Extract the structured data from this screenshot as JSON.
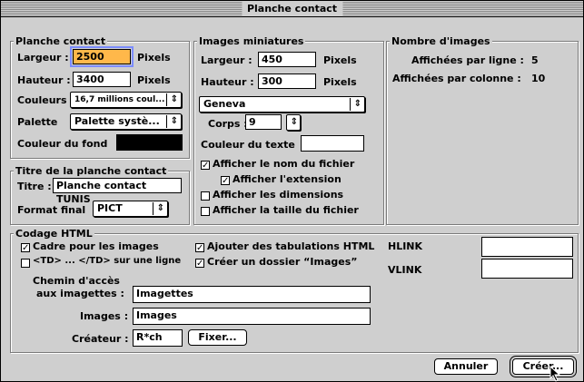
{
  "window": {
    "title": "Planche contact"
  },
  "planche": {
    "title": "Planche contact",
    "largeur_label": "Largeur :",
    "largeur_value": "2500",
    "largeur_unit": "Pixels",
    "hauteur_label": "Hauteur :",
    "hauteur_value": "3400",
    "hauteur_unit": "Pixels",
    "couleurs_label": "Couleurs",
    "couleurs_value": "16,7 millions coul...",
    "palette_label": "Palette",
    "palette_value": "Palette systè...",
    "fond_label": "Couleur du fond",
    "fond_color": "#000000"
  },
  "miniatures": {
    "title": "Images miniatures",
    "largeur_label": "Largeur :",
    "largeur_value": "450",
    "largeur_unit": "Pixels",
    "hauteur_label": "Hauteur :",
    "hauteur_value": "300",
    "hauteur_unit": "Pixels",
    "font_value": "Geneva",
    "corps_label": "Corps :",
    "corps_value": "9",
    "texte_label": "Couleur du texte",
    "texte_color": "#ffffff",
    "chk_nom": {
      "label": "Afficher le nom du fichier",
      "checked": true
    },
    "chk_ext": {
      "label": "Afficher l'extension",
      "checked": true
    },
    "chk_dim": {
      "label": "Afficher les dimensions",
      "checked": false
    },
    "chk_taille": {
      "label": "Afficher la taille du fichier",
      "checked": false
    }
  },
  "nombre": {
    "title": "Nombre d'images",
    "ligne_label": "Affichées par ligne :",
    "ligne_value": "5",
    "colonne_label": "Affichées par colonne :",
    "colonne_value": "10"
  },
  "titre": {
    "title": "Titre de la planche contact",
    "titre_label": "Titre :",
    "titre_value": "Planche contact TUNIS",
    "format_label": "Format final",
    "format_value": "PICT"
  },
  "html": {
    "title": "Codage HTML",
    "chk_cadre": {
      "label": "Cadre pour les images",
      "checked": true
    },
    "chk_td": {
      "label": "<TD> ... </TD> sur une ligne",
      "checked": false
    },
    "chk_tab": {
      "label": "Ajouter des tabulations HTML",
      "checked": true
    },
    "chk_dossier": {
      "label": "Créer un dossier “Images”",
      "checked": true
    },
    "hlink_label": "HLINK",
    "hlink_value": "",
    "vlink_label": "VLINK",
    "vlink_value": "",
    "chemin_label_1": "Chemin d'accès",
    "chemin_label_2": "aux imagettes :",
    "chemin_value": "Imagettes",
    "images_label": "Images :",
    "images_value": "Images",
    "createur_label": "Créateur :",
    "createur_value": "R*ch",
    "fixer_label": "Fixer..."
  },
  "buttons": {
    "annuler": "Annuler",
    "creer": "Créer..."
  }
}
